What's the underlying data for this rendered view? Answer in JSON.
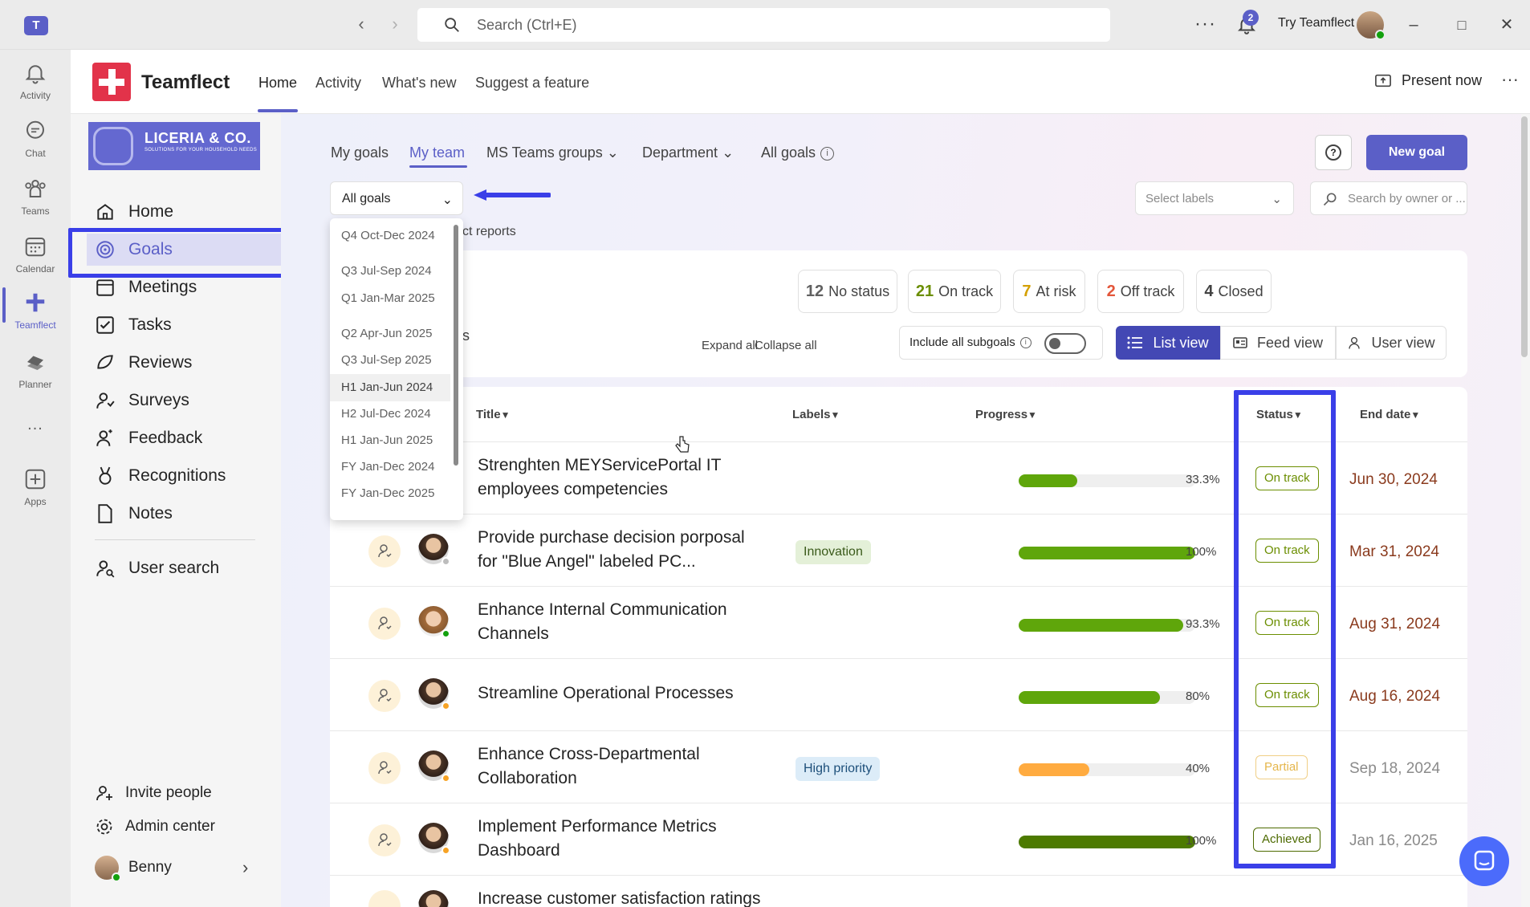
{
  "titlebar": {
    "search_placeholder": "Search (Ctrl+E)",
    "notification_count": "2",
    "try_label": "Try Teamflect"
  },
  "rail": {
    "items": [
      {
        "label": "Activity",
        "icon": "bell-icon"
      },
      {
        "label": "Chat",
        "icon": "chat-icon"
      },
      {
        "label": "Teams",
        "icon": "teams-icon"
      },
      {
        "label": "Calendar",
        "icon": "calendar-icon"
      },
      {
        "label": "Teamflect",
        "icon": "teamflect-icon"
      },
      {
        "label": "Planner",
        "icon": "planner-icon"
      },
      {
        "label": "...",
        "icon": "more-icon"
      },
      {
        "label": "Apps",
        "icon": "apps-icon"
      }
    ]
  },
  "header": {
    "app_name": "Teamflect",
    "tabs": [
      "Home",
      "Activity",
      "What's new",
      "Suggest a feature"
    ],
    "present_label": "Present now"
  },
  "brand": {
    "name": "LICERIA & CO.",
    "tagline": "SOLUTIONS FOR YOUR HOUSEHOLD NEEDS"
  },
  "sidebar": {
    "items": [
      "Home",
      "Goals",
      "Meetings",
      "Tasks",
      "Reviews",
      "Surveys",
      "Feedback",
      "Recognitions",
      "Notes"
    ],
    "user_search": "User search",
    "invite": "Invite people",
    "admin": "Admin center",
    "user": "Benny"
  },
  "goals": {
    "tabs": [
      "My goals",
      "My team",
      "MS Teams groups",
      "Department",
      "All goals"
    ],
    "new_goal": "New goal",
    "select_labels_placeholder": "Select labels",
    "search_owner_placeholder": "Search by owner or ...",
    "filter_value": "All goals",
    "direct_reports_fragment": "ct reports",
    "period_options": [
      "Q4 Oct-Dec 2024",
      "Q3 Jul-Sep 2024",
      "Q1 Jan-Mar 2025",
      "Q2 Apr-Jun 2025",
      "Q3 Jul-Sep 2025",
      "H1 Jan-Jun 2024",
      "H2 Jul-Dec 2024",
      "H1 Jan-Jun 2025",
      "FY Jan-Dec 2024",
      "FY Jan-Dec 2025"
    ],
    "selected_period": "H1 Jan-Jun 2024"
  },
  "summary": {
    "chips": [
      {
        "count": "12",
        "label": "No status",
        "color": "#616161"
      },
      {
        "count": "21",
        "label": "On track",
        "color": "#6b8e00"
      },
      {
        "count": "7",
        "label": "At risk",
        "color": "#d4a000"
      },
      {
        "count": "2",
        "label": "Off track",
        "color": "#e3563a"
      },
      {
        "count": "4",
        "label": "Closed",
        "color": "#424242"
      }
    ],
    "expand_all": "Expand all",
    "collapse_all": "Collapse all",
    "include_subgoals": "Include all subgoals",
    "fragment": "s",
    "views": [
      "List view",
      "Feed view",
      "User view"
    ]
  },
  "table": {
    "columns": [
      "Title",
      "Labels",
      "Progress",
      "Status",
      "End date"
    ],
    "rows": [
      {
        "title": "Strenghten MEYServicePortal IT employees competencies",
        "label": "",
        "progress": 33.3,
        "progress_text": "33.3%",
        "status": "On track",
        "end_date": "Jun 30, 2024"
      },
      {
        "title": "Provide purchase decision porposal for \"Blue Angel\" labeled PC...",
        "label": "Innovation",
        "progress": 100,
        "progress_text": "100%",
        "status": "On track",
        "end_date": "Mar 31, 2024"
      },
      {
        "title": "Enhance Internal Communication Channels",
        "label": "",
        "progress": 93.3,
        "progress_text": "93.3%",
        "status": "On track",
        "end_date": "Aug 31, 2024"
      },
      {
        "title": "Streamline Operational Processes",
        "label": "",
        "progress": 80,
        "progress_text": "80%",
        "status": "On track",
        "end_date": "Aug 16, 2024"
      },
      {
        "title": "Enhance Cross-Departmental Collaboration",
        "label": "High priority",
        "progress": 40,
        "progress_text": "40%",
        "status": "Partial",
        "end_date": "Sep 18, 2024"
      },
      {
        "title": "Implement Performance Metrics Dashboard",
        "label": "",
        "progress": 100,
        "progress_text": "100%",
        "status": "Achieved",
        "end_date": "Jan 16, 2025"
      },
      {
        "title": "Increase customer satisfaction ratings",
        "label": "",
        "progress": 0,
        "progress_text": "",
        "status": "",
        "end_date": ""
      }
    ]
  },
  "colors": {
    "accent": "#5b5fc7",
    "highlight": "#3a3fe8",
    "on_track": "#6b8e00",
    "partial": "#e5b64b",
    "achieved": "#4d6a00",
    "bar_green": "#5fa60b",
    "bar_orange": "#ffab40",
    "bar_dark": "#4d7a00"
  }
}
